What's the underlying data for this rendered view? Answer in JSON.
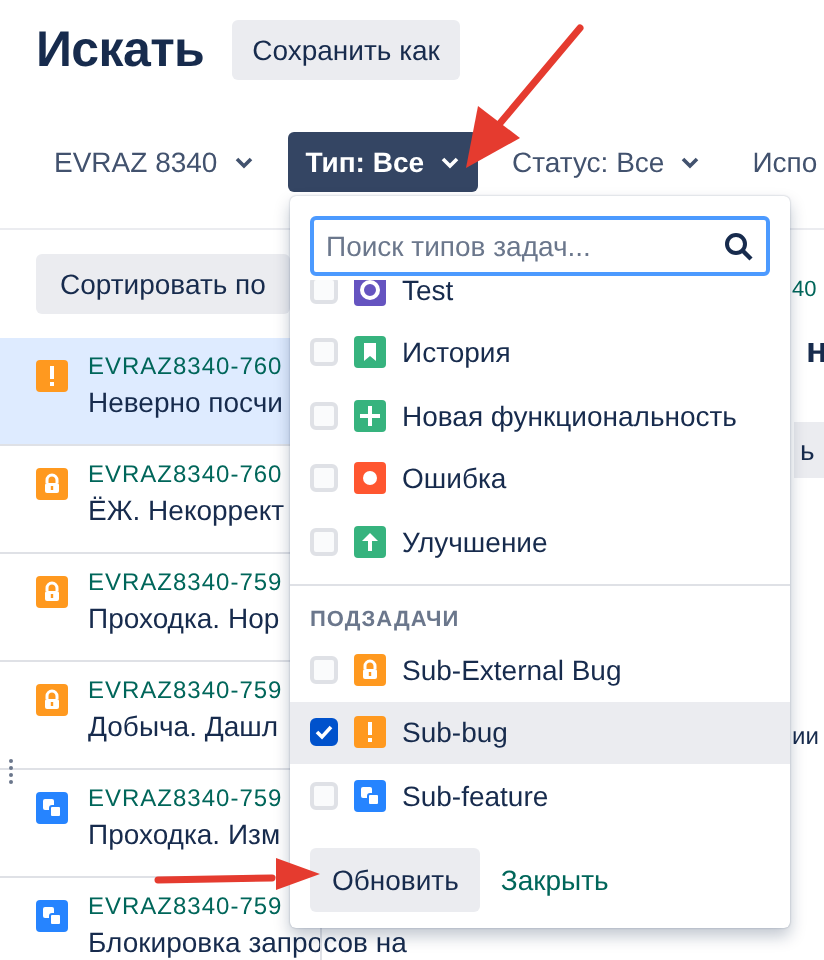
{
  "header": {
    "title": "Искать",
    "save_button": "Сохранить как"
  },
  "filters": [
    {
      "label": "EVRAZ 8340",
      "active": false
    },
    {
      "label": "Тип: Все",
      "active": true
    },
    {
      "label": "Статус: Все",
      "active": false
    },
    {
      "label": "Испо",
      "active": false
    }
  ],
  "sort_button": "Сортировать по",
  "issues": [
    {
      "kind": "bug",
      "key": "EVRAZ8340-760",
      "summary": "Неверно посчи",
      "selected": true
    },
    {
      "kind": "lock",
      "key": "EVRAZ8340-760",
      "summary": "ЁЖ. Некоррект",
      "selected": false
    },
    {
      "kind": "lock",
      "key": "EVRAZ8340-759",
      "summary": "Проходка. Нор",
      "selected": false
    },
    {
      "kind": "lock",
      "key": "EVRAZ8340-759",
      "summary": "Добыча. Дашл",
      "selected": false
    },
    {
      "kind": "subtask",
      "key": "EVRAZ8340-759",
      "summary": "Проходка. Изм",
      "selected": false
    },
    {
      "kind": "subtask",
      "key": "EVRAZ8340-759",
      "summary": "Блокировка запросов на",
      "selected": false
    }
  ],
  "detail_fragments": [
    "40",
    "н",
    "ь",
    "ии"
  ],
  "dropdown": {
    "placeholder": "Поиск типов задач...",
    "items": [
      {
        "kind": "test",
        "label": "Test",
        "checked": false,
        "hovered": false
      },
      {
        "kind": "story",
        "label": "История",
        "checked": false,
        "hovered": false
      },
      {
        "kind": "feature",
        "label": "Новая функциональность",
        "checked": false,
        "hovered": false
      },
      {
        "kind": "error",
        "label": "Ошибка",
        "checked": false,
        "hovered": false
      },
      {
        "kind": "improvement",
        "label": "Улучшение",
        "checked": false,
        "hovered": false
      }
    ],
    "section": "ПОДЗАДАЧИ",
    "subitems": [
      {
        "kind": "lock",
        "label": "Sub-External Bug",
        "checked": false,
        "hovered": false
      },
      {
        "kind": "bug",
        "label": "Sub-bug",
        "checked": true,
        "hovered": true
      },
      {
        "kind": "subtask",
        "label": "Sub-feature",
        "checked": false,
        "hovered": false
      }
    ],
    "update_button": "Обновить",
    "close_link": "Закрыть"
  },
  "annotations": [
    {
      "kind": "arrow"
    },
    {
      "kind": "arrow"
    }
  ]
}
